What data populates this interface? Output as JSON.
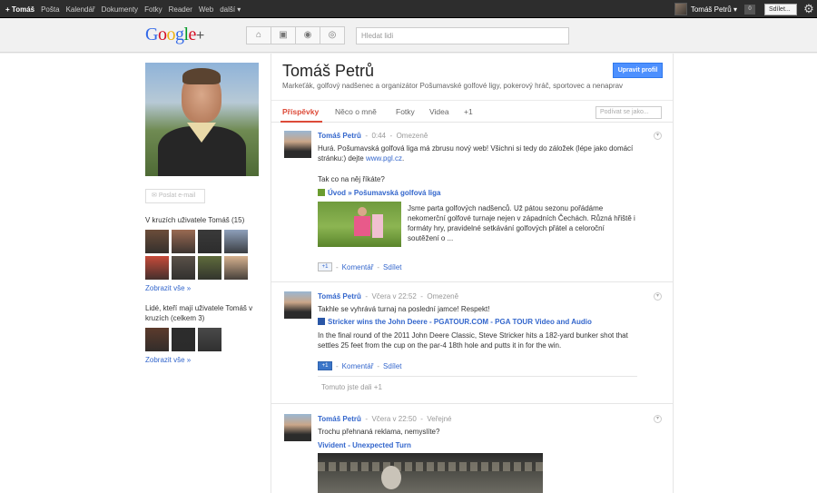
{
  "topbar": {
    "nav": [
      "+ Tomáš",
      "Pošta",
      "Kalendář",
      "Dokumenty",
      "Fotky",
      "Reader",
      "Web",
      "další ▾"
    ],
    "user": "Tomáš Petrů ▾",
    "notifications": "0",
    "share_label": "Sdílet..."
  },
  "header": {
    "logo_text": "Google",
    "logo_plus": "+",
    "search_placeholder": "Hledat lidi",
    "nav_icons": [
      "home-icon",
      "photos-icon",
      "profile-icon",
      "circles-icon"
    ]
  },
  "profile": {
    "name": "Tomáš Petrů",
    "tagline": "Markeťák, golfový nadšenec a organizátor Pošumavské golfové ligy, pokerový hráč, sportovec a nenaprav",
    "edit_button": "Upravit profil",
    "email_button": "Poslat e-mail",
    "tabs": [
      "Příspěvky",
      "Něco o mně",
      "Fotky",
      "Videa",
      "+1"
    ],
    "filter_placeholder": "Podívat se jako..."
  },
  "sidebar": {
    "circles_title": "V kruzích uživatele Tomáš (15)",
    "circles_more": "Zobrazit vše »",
    "in_circles_title": "Lidé, kteří mají uživatele Tomáš v kruzích (celkem 3)",
    "in_circles_more": "Zobrazit vše »",
    "circle_avatar_colors": [
      "#6b4d3a",
      "#9a6a52",
      "#3a3a3a",
      "#8ea0bb",
      "#c74b3a",
      "#5a5148",
      "#5f6b3c",
      "#d7b28f"
    ],
    "in_circle_avatar_colors": [
      "#5c3b2c",
      "#2d2d2d",
      "#4a4a4a"
    ]
  },
  "posts": [
    {
      "author": "Tomáš Petrů",
      "time": "0:44",
      "visibility": "Omezeně",
      "text": "Hurá. Pošumavská golfová liga má zbrusu nový web! Všichni si tedy do záložek (lépe jako domácí stránku:) dejte",
      "text_link": "www.pgl.cz",
      "text2": "Tak co na něj říkáte?",
      "link_title": "Úvod » Pošumavská golfová liga",
      "link_desc": "Jsme parta golfových nadšenců. Už pátou sezonu pořádáme nekomerční golfové turnaje nejen v západních Čechách. Různá hřiště i formáty hry, pravidelné setkávání golfových přátel a celoroční soutěžení o ...",
      "plus": "+1",
      "comment": "Komentář",
      "share": "Sdílet"
    },
    {
      "author": "Tomáš Petrů",
      "time": "Včera v 22:52",
      "visibility": "Omezeně",
      "text": "Takhle se vyhrává turnaj na poslední jamce! Respekt!",
      "link_title": "Stricker wins the John Deere - PGATOUR.COM - PGA TOUR Video and Audio",
      "link_desc": "In the final round of the 2011 John Deere Classic, Steve Stricker hits a 182-yard bunker shot that settles 25 feet from the cup on the par-4 18th hole and putts it in for the win.",
      "plus": "+1",
      "comment": "Komentář",
      "share": "Sdílet",
      "plusoned": "Tomuto jste dali +1"
    },
    {
      "author": "Tomáš Petrů",
      "time": "Včera v 22:50",
      "visibility": "Veřejné",
      "text": "Trochu přehnaná reklama, nemyslíte?",
      "link_title": "Vivident - Unexpected Turn"
    }
  ]
}
